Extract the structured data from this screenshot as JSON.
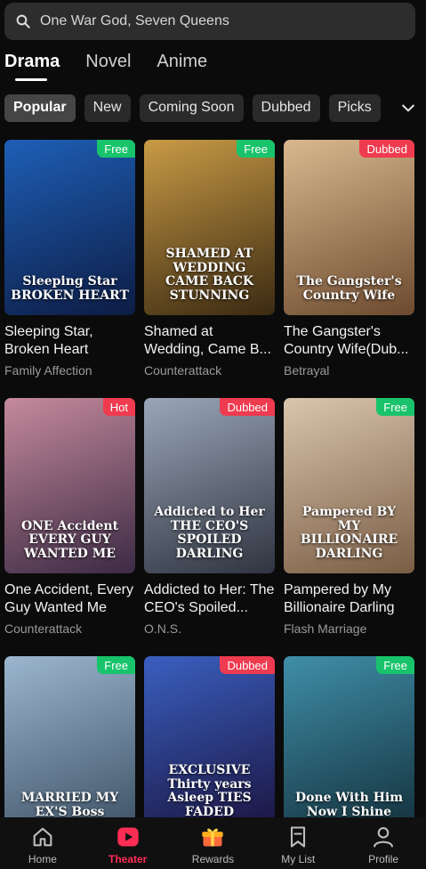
{
  "search": {
    "text": "One War God, Seven Queens"
  },
  "tabs": [
    {
      "label": "Drama",
      "active": true
    },
    {
      "label": "Novel",
      "active": false
    },
    {
      "label": "Anime",
      "active": false
    }
  ],
  "chips": [
    {
      "label": "Popular",
      "active": true
    },
    {
      "label": "New"
    },
    {
      "label": "Coming Soon"
    },
    {
      "label": "Dubbed"
    },
    {
      "label": "Picks"
    }
  ],
  "cards": [
    {
      "title": "Sleeping Star, Broken Heart",
      "genre": "Family Affection",
      "badge": "Free",
      "poster_text": "Sleeping Star BROKEN HEART",
      "colors": [
        "#1e5fb6",
        "#0d1c44"
      ]
    },
    {
      "title": "Shamed at Wedding, Came B...",
      "genre": "Counterattack",
      "badge": "Free",
      "poster_text": "SHAMED AT WEDDING CAME BACK STUNNING",
      "colors": [
        "#c89a45",
        "#3b2a12"
      ]
    },
    {
      "title": "The Gangster's Country Wife(Dub...",
      "genre": "Betrayal",
      "badge": "Dubbed",
      "poster_text": "The Gangster's Country Wife",
      "colors": [
        "#d8b98e",
        "#6d4a2f"
      ]
    },
    {
      "title": "One Accident, Every Guy Wanted Me",
      "genre": "Counterattack",
      "badge": "Hot",
      "poster_text": "ONE Accident EVERY GUY WANTED ME",
      "colors": [
        "#c58a9c",
        "#3c2a44"
      ]
    },
    {
      "title": "Addicted to Her: The CEO's Spoiled...",
      "genre": "O.N.S.",
      "badge": "Dubbed",
      "poster_text": "Addicted to Her THE CEO'S SPOILED DARLING",
      "colors": [
        "#9aa6b8",
        "#2f3440"
      ]
    },
    {
      "title": "Pampered by My Billionaire Darling",
      "genre": "Flash Marriage",
      "badge": "Free",
      "poster_text": "Pampered BY MY BILLIONAIRE DARLING",
      "colors": [
        "#d9c5ad",
        "#7a5d44"
      ]
    },
    {
      "title": "",
      "genre": "",
      "badge": "Free",
      "poster_text": "MARRIED MY EX'S Boss",
      "colors": [
        "#9cb6cf",
        "#3d5266"
      ]
    },
    {
      "title": "",
      "genre": "",
      "badge": "Dubbed",
      "poster_text": "EXCLUSIVE Thirty years Asleep TIES FADED",
      "colors": [
        "#3a5fbf",
        "#1b1440"
      ]
    },
    {
      "title": "",
      "genre": "",
      "badge": "Free",
      "poster_text": "Done With Him Now I Shine",
      "colors": [
        "#3f8ea8",
        "#14313c"
      ]
    }
  ],
  "nav": [
    {
      "label": "Home",
      "icon": "home-icon",
      "active": false
    },
    {
      "label": "Theater",
      "icon": "play-icon",
      "active": true
    },
    {
      "label": "Rewards",
      "icon": "gift-icon",
      "active": false
    },
    {
      "label": "My List",
      "icon": "bookmark-icon",
      "active": false
    },
    {
      "label": "Profile",
      "icon": "profile-icon",
      "active": false
    }
  ],
  "colors": {
    "accent": "#ff2d55",
    "free": "#19c36b",
    "dubbed": "#ef3b4f"
  }
}
